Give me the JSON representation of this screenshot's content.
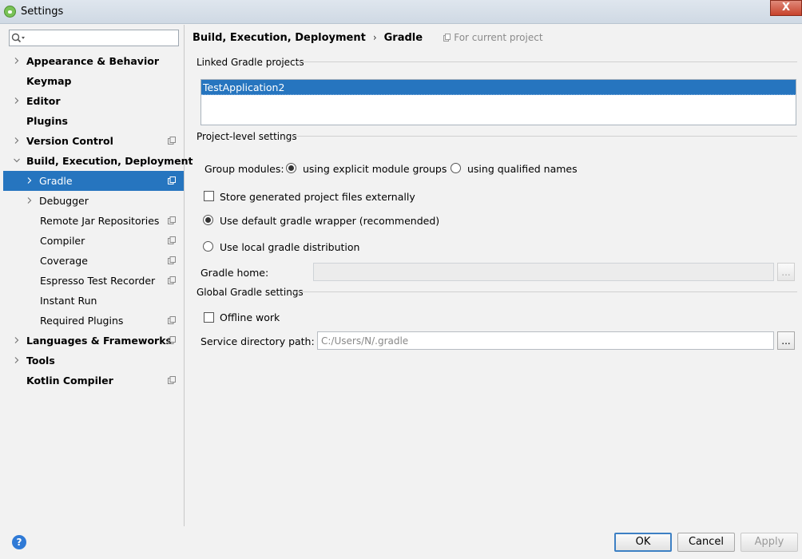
{
  "window": {
    "title": "Settings",
    "close_label": "X"
  },
  "search": {
    "placeholder": "",
    "value": ""
  },
  "sidebar": {
    "items": [
      {
        "label": "Appearance & Behavior",
        "level": 0,
        "bold": true,
        "chevron": "right",
        "project_icon": false
      },
      {
        "label": "Keymap",
        "level": 0,
        "bold": true,
        "chevron": "none",
        "project_icon": false
      },
      {
        "label": "Editor",
        "level": 0,
        "bold": true,
        "chevron": "right",
        "project_icon": false
      },
      {
        "label": "Plugins",
        "level": 0,
        "bold": true,
        "chevron": "none",
        "project_icon": false
      },
      {
        "label": "Version Control",
        "level": 0,
        "bold": true,
        "chevron": "right",
        "project_icon": true
      },
      {
        "label": "Build, Execution, Deployment",
        "level": 0,
        "bold": true,
        "chevron": "down",
        "project_icon": false
      },
      {
        "label": "Gradle",
        "level": 1,
        "bold": false,
        "chevron": "right",
        "project_icon": true,
        "selected": true
      },
      {
        "label": "Debugger",
        "level": 1,
        "bold": false,
        "chevron": "right",
        "project_icon": false
      },
      {
        "label": "Remote Jar Repositories",
        "level": 1,
        "bold": false,
        "chevron": "none",
        "project_icon": true
      },
      {
        "label": "Compiler",
        "level": 1,
        "bold": false,
        "chevron": "none",
        "project_icon": true
      },
      {
        "label": "Coverage",
        "level": 1,
        "bold": false,
        "chevron": "none",
        "project_icon": true
      },
      {
        "label": "Espresso Test Recorder",
        "level": 1,
        "bold": false,
        "chevron": "none",
        "project_icon": true
      },
      {
        "label": "Instant Run",
        "level": 1,
        "bold": false,
        "chevron": "none",
        "project_icon": false
      },
      {
        "label": "Required Plugins",
        "level": 1,
        "bold": false,
        "chevron": "none",
        "project_icon": true
      },
      {
        "label": "Languages & Frameworks",
        "level": 0,
        "bold": true,
        "chevron": "right",
        "project_icon": true
      },
      {
        "label": "Tools",
        "level": 0,
        "bold": true,
        "chevron": "right",
        "project_icon": false
      },
      {
        "label": "Kotlin Compiler",
        "level": 0,
        "bold": true,
        "chevron": "none",
        "project_icon": true
      }
    ]
  },
  "breadcrumb": {
    "parent": "Build, Execution, Deployment",
    "sep": "›",
    "current": "Gradle",
    "scope": "For current project"
  },
  "linked": {
    "title": "Linked Gradle projects",
    "items": [
      "TestApplication2"
    ]
  },
  "project_level": {
    "title": "Project-level settings",
    "group_modules_label": "Group modules:",
    "group_option_explicit": "using explicit module groups",
    "group_option_qualified": "using qualified names",
    "group_selected": "explicit",
    "store_externally_label": "Store generated project files externally",
    "store_externally_checked": false,
    "wrapper_label": "Use default gradle wrapper (recommended)",
    "local_label": "Use local gradle distribution",
    "distribution_selected": "wrapper",
    "gradle_home_label": "Gradle home:",
    "gradle_home_value": "",
    "browse_label": "..."
  },
  "global": {
    "title": "Global Gradle settings",
    "offline_label": "Offline work",
    "offline_checked": false,
    "service_dir_label": "Service directory path:",
    "service_dir_value": "C:/Users/N/.gradle",
    "browse_label": "..."
  },
  "buttons": {
    "help": "?",
    "ok": "OK",
    "cancel": "Cancel",
    "apply": "Apply"
  },
  "colors": {
    "selection": "#2675bf",
    "accent_border": "#3d80c4"
  }
}
